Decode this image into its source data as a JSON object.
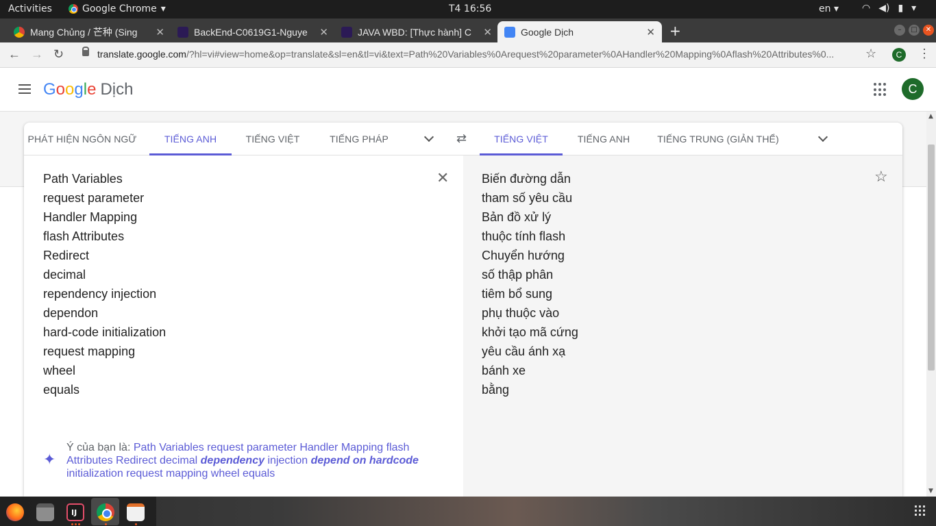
{
  "system": {
    "activities": "Activities",
    "app_name": "Google Chrome",
    "clock": "T4 16:56",
    "lang": "en"
  },
  "tabs": [
    {
      "title": "Mang Chủng / 芒种 (Sing",
      "icon": "music-favicon"
    },
    {
      "title": "BackEnd-C0619G1-Nguye",
      "icon": "gitlab-favicon"
    },
    {
      "title": "JAVA WBD: [Thực hành] C",
      "icon": "gitlab-favicon"
    },
    {
      "title": "Google Dịch",
      "icon": "google-translate-favicon",
      "active": true
    }
  ],
  "omnibox": {
    "host": "translate.google.com",
    "path": "/?hl=vi#view=home&op=translate&sl=en&tl=vi&text=Path%20Variables%0Arequest%20parameter%0AHandler%20Mapping%0Aflash%20Attributes%0..."
  },
  "header": {
    "logo_letters": [
      "G",
      "o",
      "o",
      "g",
      "l",
      "e"
    ],
    "product": "Dịch",
    "avatar": "C"
  },
  "source_langs": [
    "PHÁT HIỆN NGÔN NGỮ",
    "TIẾNG ANH",
    "TIẾNG VIỆT",
    "TIẾNG PHÁP"
  ],
  "target_langs": [
    "TIẾNG VIỆT",
    "TIẾNG ANH",
    "TIẾNG TRUNG (GIẢN THỂ)"
  ],
  "source_lines": [
    "Path Variables",
    "request parameter",
    "Handler Mapping",
    "flash Attributes",
    "Redirect",
    "decimal",
    "rependency injection",
    "dependon",
    "hard-code initialization",
    "request mapping",
    "wheel",
    "equals"
  ],
  "target_lines": [
    "Biến đường dẫn",
    "tham số yêu cầu",
    "Bản đồ xử lý",
    "thuộc tính flash",
    "Chuyển hướng",
    "số thập phân",
    "tiêm bổ sung",
    "phụ thuộc vào",
    "khởi tạo mã cứng",
    "yêu cầu ánh xạ",
    "bánh xe",
    "bằng"
  ],
  "suggestion": {
    "prefix": "Ý của bạn là: ",
    "part1": "Path Variables request parameter Handler Mapping flash Attributes Redirect decimal ",
    "bold1": "dependency",
    "part2": " injection ",
    "bold2": "depend on hardcode",
    "part3": " initialization request mapping wheel equals"
  },
  "colors": {
    "accent": "#5b5bd6",
    "ubuntu_bar": "#1d1d1d",
    "tab_strip": "#3b3b3b"
  }
}
